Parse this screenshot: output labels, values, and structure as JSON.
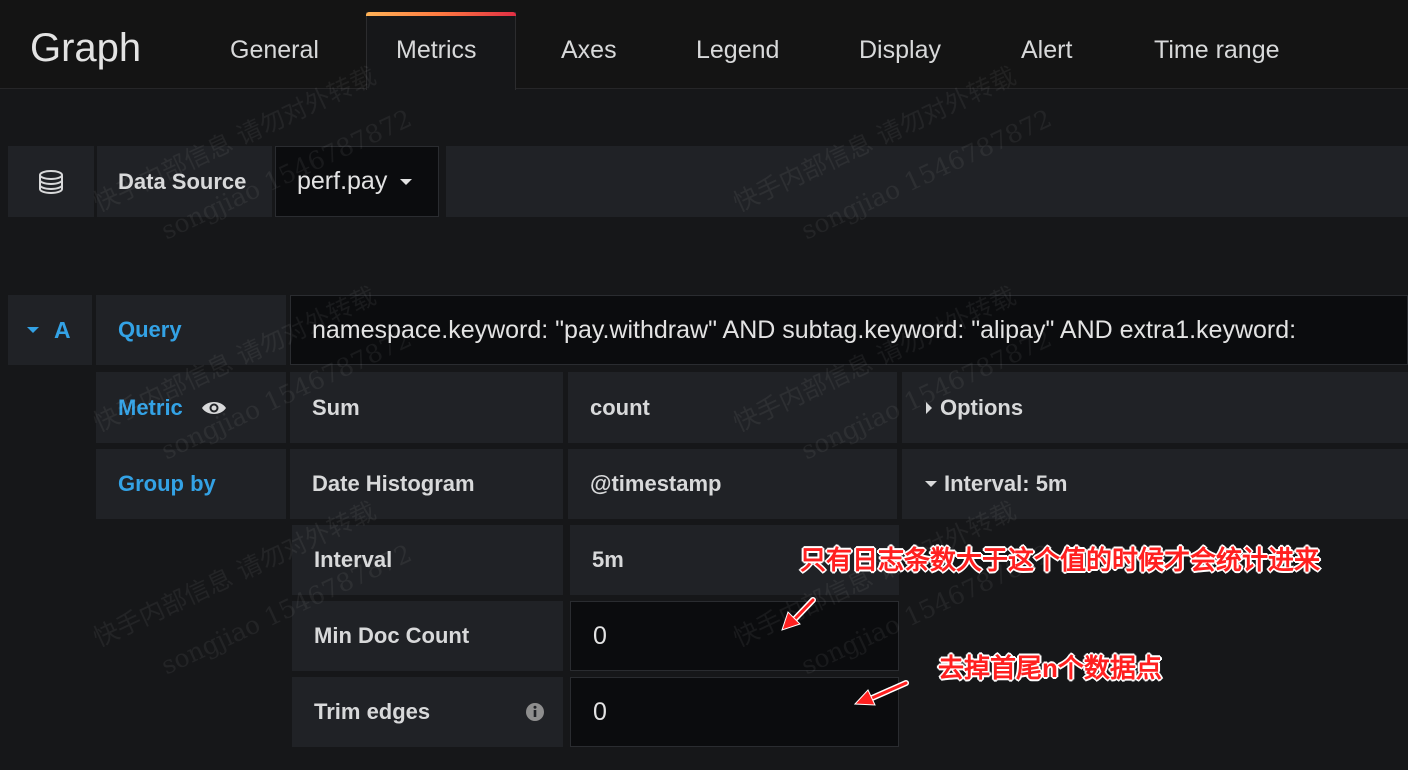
{
  "header": {
    "title": "Graph",
    "tabs": [
      "General",
      "Metrics",
      "Axes",
      "Legend",
      "Display",
      "Alert",
      "Time range"
    ]
  },
  "datasource": {
    "label": "Data Source",
    "value": "perf.pay",
    "icon": "database-icon"
  },
  "query": {
    "ref": "A",
    "query_label": "Query",
    "query_text": "namespace.keyword: \"pay.withdraw\" AND subtag.keyword: \"alipay\" AND extra1.keyword:",
    "metric_label": "Metric",
    "metric_agg": "Sum",
    "metric_field": "count",
    "metric_options": "Options",
    "groupby_label": "Group by",
    "groupby_type": "Date Histogram",
    "groupby_field": "@timestamp",
    "groupby_interval": "Interval: 5m",
    "interval_label": "Interval",
    "interval_value": "5m",
    "min_doc_label": "Min Doc Count",
    "min_doc_value": "0",
    "trim_label": "Trim edges",
    "trim_value": "0"
  },
  "annotations": {
    "note1": "只有日志条数大于这个值的时候才会统计进来",
    "note2": "去掉首尾n个数据点",
    "color": "#ff2020"
  },
  "watermark": {
    "line1": "快手内部信息 请勿对外转载",
    "line2": "songjiao 1546787872"
  },
  "colors": {
    "accent": "#33a2e5",
    "tab_gradient": [
      "#ffb357",
      "#ff7941",
      "#e02f44"
    ]
  }
}
